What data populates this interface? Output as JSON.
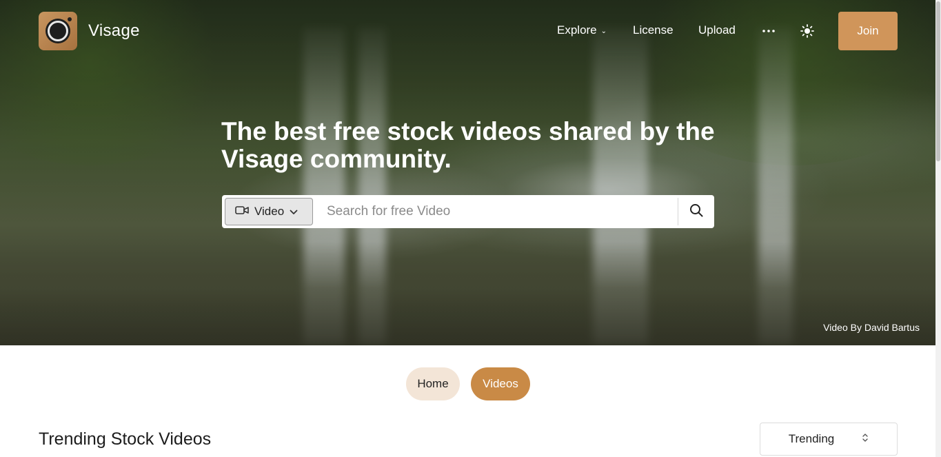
{
  "header": {
    "brand": "Visage",
    "nav": {
      "explore": "Explore",
      "license": "License",
      "upload": "Upload",
      "more_icon": "more-dots-icon",
      "theme_icon": "sun-icon"
    },
    "join_label": "Join"
  },
  "hero": {
    "headline": "The best free stock videos shared by the Visage community.",
    "search": {
      "type_label": "Video",
      "type_icon": "video-camera-icon",
      "placeholder": "Search for free Video",
      "value": "",
      "button_icon": "search-icon"
    },
    "credit": "Video By David Bartus"
  },
  "tabs": {
    "home": "Home",
    "videos": "Videos",
    "active": "Videos"
  },
  "section": {
    "title": "Trending Stock Videos",
    "sort_value": "Trending"
  },
  "colors": {
    "accent": "#d0955a",
    "active_pill": "#c98a46",
    "inactive_pill": "#f3e5d7"
  }
}
